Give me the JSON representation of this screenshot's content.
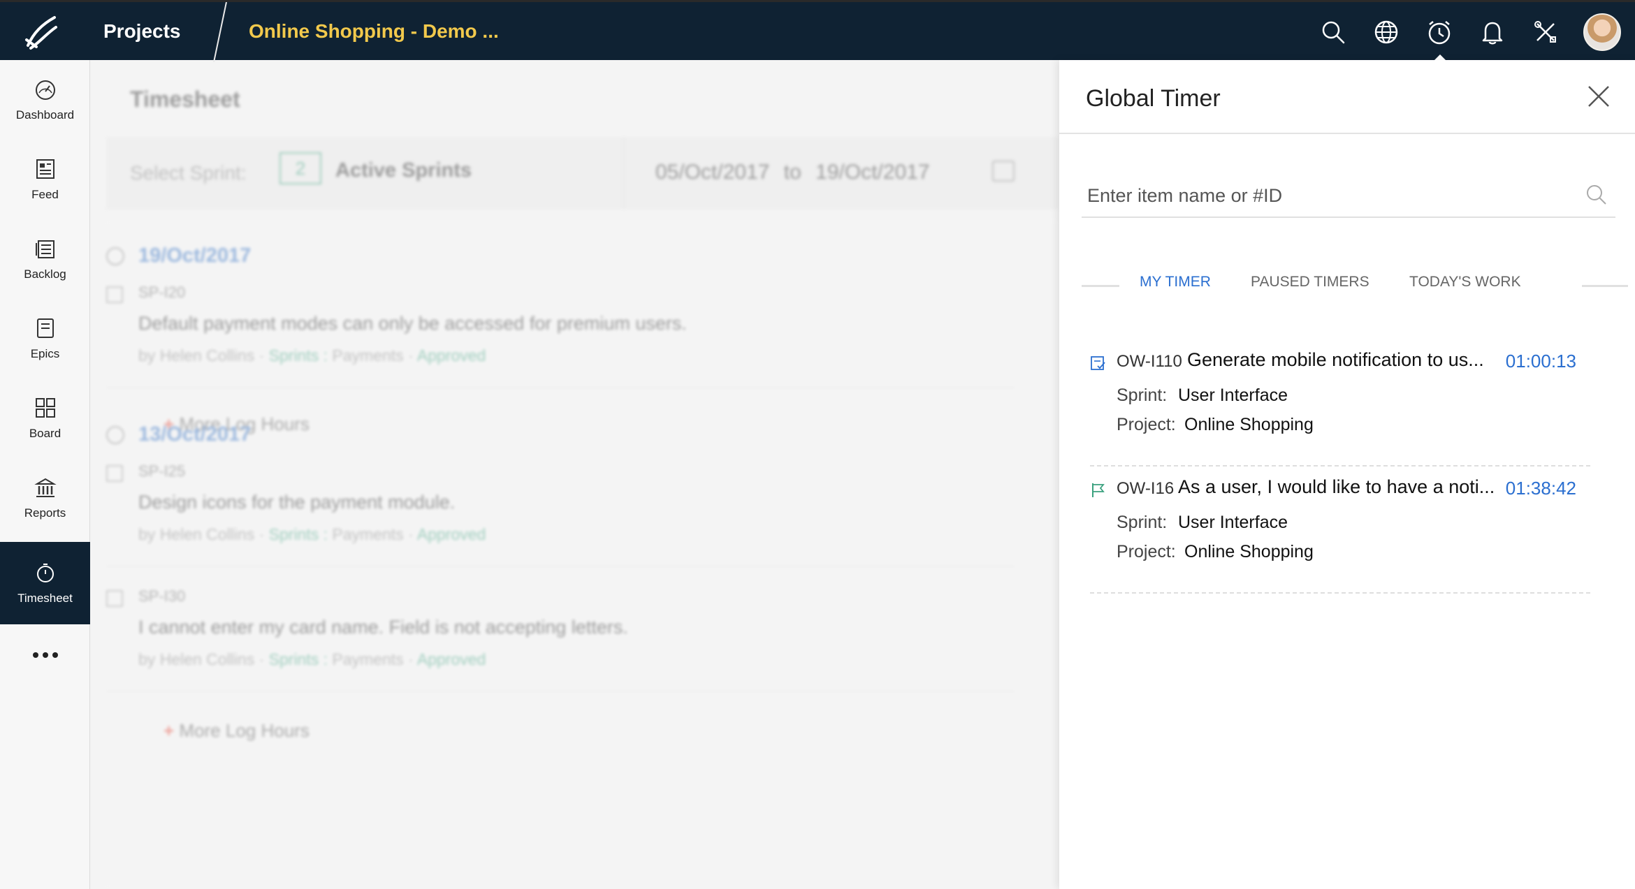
{
  "header": {
    "title": "Projects",
    "breadcrumb": "Online Shopping - Demo ..."
  },
  "colors": {
    "topbar": "#0f2233",
    "breadcrumb": "#f2c94c",
    "accent": "#2b6fd0",
    "green": "#3aa17e"
  },
  "top_icons": [
    "search-icon",
    "globe-icon",
    "timer-icon",
    "bell-icon",
    "tools-icon",
    "avatar"
  ],
  "sidebar": {
    "items": [
      {
        "label": "Dashboard",
        "icon": "dashboard-icon"
      },
      {
        "label": "Feed",
        "icon": "feed-icon"
      },
      {
        "label": "Backlog",
        "icon": "backlog-icon"
      },
      {
        "label": "Epics",
        "icon": "epics-icon"
      },
      {
        "label": "Board",
        "icon": "board-icon"
      },
      {
        "label": "Reports",
        "icon": "reports-icon"
      },
      {
        "label": "Timesheet",
        "icon": "stopwatch-icon",
        "active": true
      }
    ]
  },
  "timesheet": {
    "title": "Timesheet",
    "select_sprint_label": "Select Sprint:",
    "sprint_count": "2",
    "active_sprints": "Active Sprints",
    "date_from": "05/Oct/2017",
    "date_to_word": "to",
    "date_to": "19/Oct/2017",
    "more_log_hours": "More Log Hours",
    "days": [
      {
        "date": "19/Oct/2017",
        "items": [
          {
            "id": "SP-I20",
            "title": "Default payment modes can only be accessed for premium users.",
            "by": "by",
            "user": "Helen Collins",
            "sprints_label": "Sprints :",
            "sprint": "Payments",
            "status": "Approved"
          }
        ]
      },
      {
        "date": "13/Oct/2017",
        "items": [
          {
            "id": "SP-I25",
            "title": "Design icons for the payment module.",
            "by": "by",
            "user": "Helen Collins",
            "sprints_label": "Sprints :",
            "sprint": "Payments",
            "status": "Approved"
          },
          {
            "id": "SP-I30",
            "title": "I cannot enter my card name. Field is not accepting letters.",
            "by": "by",
            "user": "Helen Collins",
            "sprints_label": "Sprints :",
            "sprint": "Payments",
            "status": "Approved"
          }
        ]
      }
    ]
  },
  "global_timer": {
    "title": "Global Timer",
    "search_placeholder": "Enter item name or #ID",
    "tabs": [
      "MY TIMER",
      "PAUSED TIMERS",
      "TODAY'S WORK"
    ],
    "active_tab": "MY TIMER",
    "sprint_label": "Sprint:",
    "project_label": "Project:",
    "entries": [
      {
        "id": "OW-I110",
        "title": "Generate mobile notification to us...",
        "time": "01:00:13",
        "sprint": "User Interface",
        "project": "Online Shopping",
        "icon": "task-icon"
      },
      {
        "id": "OW-I16",
        "title": "As a user, I would like to have a noti...",
        "time": "01:38:42",
        "sprint": "User Interface",
        "project": "Online Shopping",
        "icon": "flag-icon"
      }
    ]
  }
}
